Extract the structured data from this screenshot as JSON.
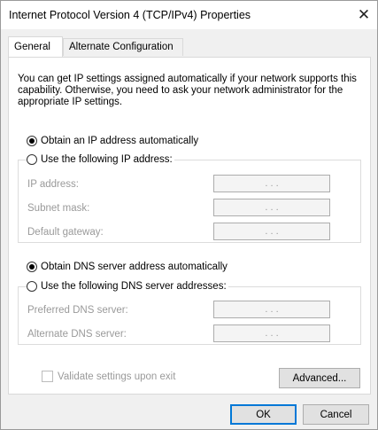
{
  "window": {
    "title": "Internet Protocol Version 4 (TCP/IPv4) Properties",
    "close_glyph": "✕"
  },
  "tabs": [
    {
      "label": "General",
      "active": true
    },
    {
      "label": "Alternate Configuration",
      "active": false
    }
  ],
  "general": {
    "description": "You can get IP settings assigned automatically if your network supports this capability. Otherwise, you need to ask your network administrator for the appropriate IP settings.",
    "ip_mode": {
      "auto_label": "Obtain an IP address automatically",
      "manual_label": "Use the following IP address:",
      "selected": "auto"
    },
    "ip_fields": [
      {
        "label": "IP address:",
        "value": ". . ."
      },
      {
        "label": "Subnet mask:",
        "value": ". . ."
      },
      {
        "label": "Default gateway:",
        "value": ". . ."
      }
    ],
    "dns_mode": {
      "auto_label": "Obtain DNS server address automatically",
      "manual_label": "Use the following DNS server addresses:",
      "selected": "auto"
    },
    "dns_fields": [
      {
        "label": "Preferred DNS server:",
        "value": ". . ."
      },
      {
        "label": "Alternate DNS server:",
        "value": ". . ."
      }
    ],
    "validate_label": "Validate settings upon exit",
    "validate_checked": false,
    "advanced_label": "Advanced..."
  },
  "footer": {
    "ok_label": "OK",
    "cancel_label": "Cancel"
  },
  "colors": {
    "accent": "#0078d7",
    "disabled_text": "#9a9a9a"
  }
}
